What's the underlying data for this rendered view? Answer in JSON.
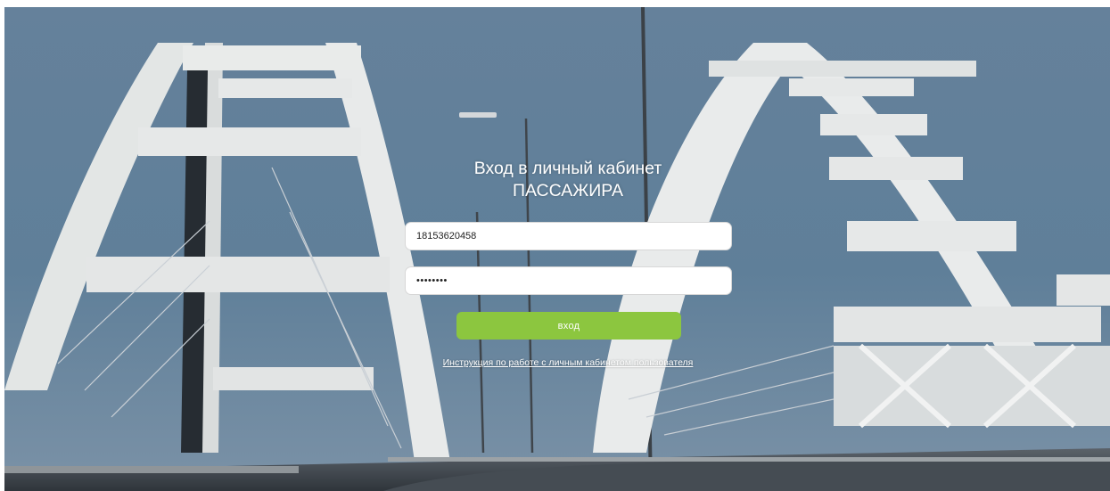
{
  "login": {
    "title_line1": "Вход в личный кабинет",
    "title_line2": "ПАССАЖИРА",
    "login_value": "18153620458",
    "password_value": "12345678",
    "submit_label": "вход",
    "help_link": "Инструкция по работе с личным кабинетом пользователя"
  },
  "colors": {
    "button": "#8cc63f",
    "sky": "#5c7a97",
    "bridge": "#e5e7e6"
  }
}
